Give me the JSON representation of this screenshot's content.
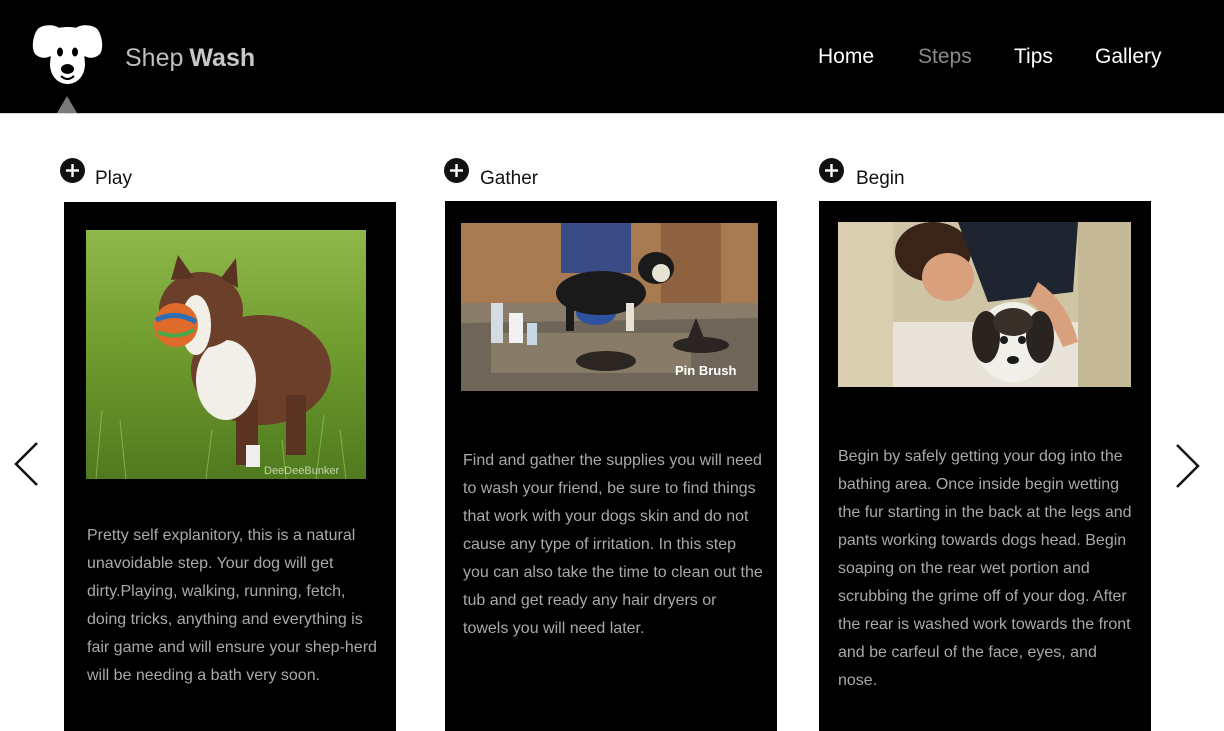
{
  "header": {
    "brand_first": "Shep",
    "brand_second": "Wash",
    "nav": [
      {
        "label": "Home",
        "active": false
      },
      {
        "label": "Steps",
        "active": true
      },
      {
        "label": "Tips",
        "active": false
      },
      {
        "label": "Gallery",
        "active": false
      }
    ]
  },
  "steps": [
    {
      "title": "Play",
      "image_watermark": "DeeDeeBunker",
      "text": "Pretty self explanitory, this is a natural unavoidable step. Your dog will get dirty.Playing, walking, running, fetch, doing tricks, anything and everything is fair game and will ensure your shep-herd will be needing a bath very soon."
    },
    {
      "title": "Gather",
      "image_caption": "Pin Brush",
      "text": "Find and gather the supplies you will need to wash your friend, be sure to find things that work with your dogs skin and do not cause any type of irritation. In this step you can also take the time to clean out the tub and get ready any hair dryers or towels you will need later."
    },
    {
      "title": "Begin",
      "text": "Begin by safely getting your dog into the bathing area. Once inside begin wetting the fur starting in the back at the legs and pants working towards dogs head. Begin soaping on the rear wet portion and scrubbing the grime off of your dog. After the rear is washed work towards the front and be carfeul of the face, eyes, and nose."
    }
  ],
  "icons": {
    "logo": "dog-face-icon",
    "expand": "plus-circle-icon",
    "prev": "chevron-left-icon",
    "next": "chevron-right-icon"
  }
}
